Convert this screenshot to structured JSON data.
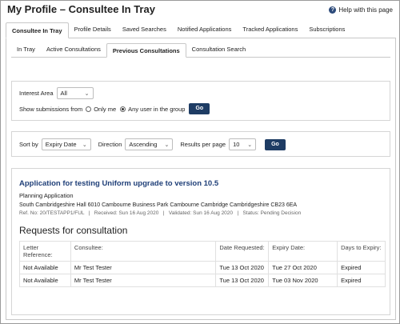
{
  "page": {
    "title": "My Profile – Consultee In Tray",
    "help_label": "Help with this page",
    "help_icon": "help-icon"
  },
  "main_tabs": [
    {
      "label": "Consultee In Tray",
      "active": true
    },
    {
      "label": "Profile Details",
      "active": false
    },
    {
      "label": "Saved Searches",
      "active": false
    },
    {
      "label": "Notified Applications",
      "active": false
    },
    {
      "label": "Tracked Applications",
      "active": false
    },
    {
      "label": "Subscriptions",
      "active": false
    }
  ],
  "sub_tabs": [
    {
      "label": "In Tray",
      "active": false
    },
    {
      "label": "Active Consultations",
      "active": false
    },
    {
      "label": "Previous Consultations",
      "active": true
    },
    {
      "label": "Consultation Search",
      "active": false
    }
  ],
  "filter": {
    "interest_area_label": "Interest Area",
    "interest_area_value": "All",
    "show_submissions_label": "Show submissions from",
    "option_only_me": "Only me",
    "option_any_user": "Any user in the group",
    "selected_option": "any_user",
    "go_label": "Go"
  },
  "sort": {
    "sort_by_label": "Sort by",
    "sort_by_value": "Expiry Date",
    "direction_label": "Direction",
    "direction_value": "Ascending",
    "results_label": "Results per page",
    "results_value": "10",
    "go_label": "Go"
  },
  "application": {
    "title": "Application for testing Uniform upgrade to version 10.5",
    "type": "Planning Application",
    "address": "South Cambridgeshire Hall 6010 Cambourne Business Park Cambourne Cambridge Cambridgeshire CB23 6EA",
    "meta": "Ref. No: 20/TESTAPP1/FUL   |   Received: Sun 16 Aug 2020   |   Validated: Sun 16 Aug 2020   |   Status: Pending Decision"
  },
  "requests": {
    "heading": "Requests for consultation",
    "columns": [
      "Letter Reference:",
      "Consultee:",
      "Date Requested:",
      "Expiry Date:",
      "Days to Expiry:"
    ],
    "rows": [
      [
        "Not Available",
        "Mr Test Tester",
        "Tue 13 Oct 2020",
        "Tue 27 Oct 2020",
        "Expired"
      ],
      [
        "Not Available",
        "Mr Test Tester",
        "Tue 13 Oct 2020",
        "Tue 03 Nov 2020",
        "Expired"
      ]
    ]
  },
  "colors": {
    "accent": "#1e3c64",
    "link": "#1f3f78"
  }
}
